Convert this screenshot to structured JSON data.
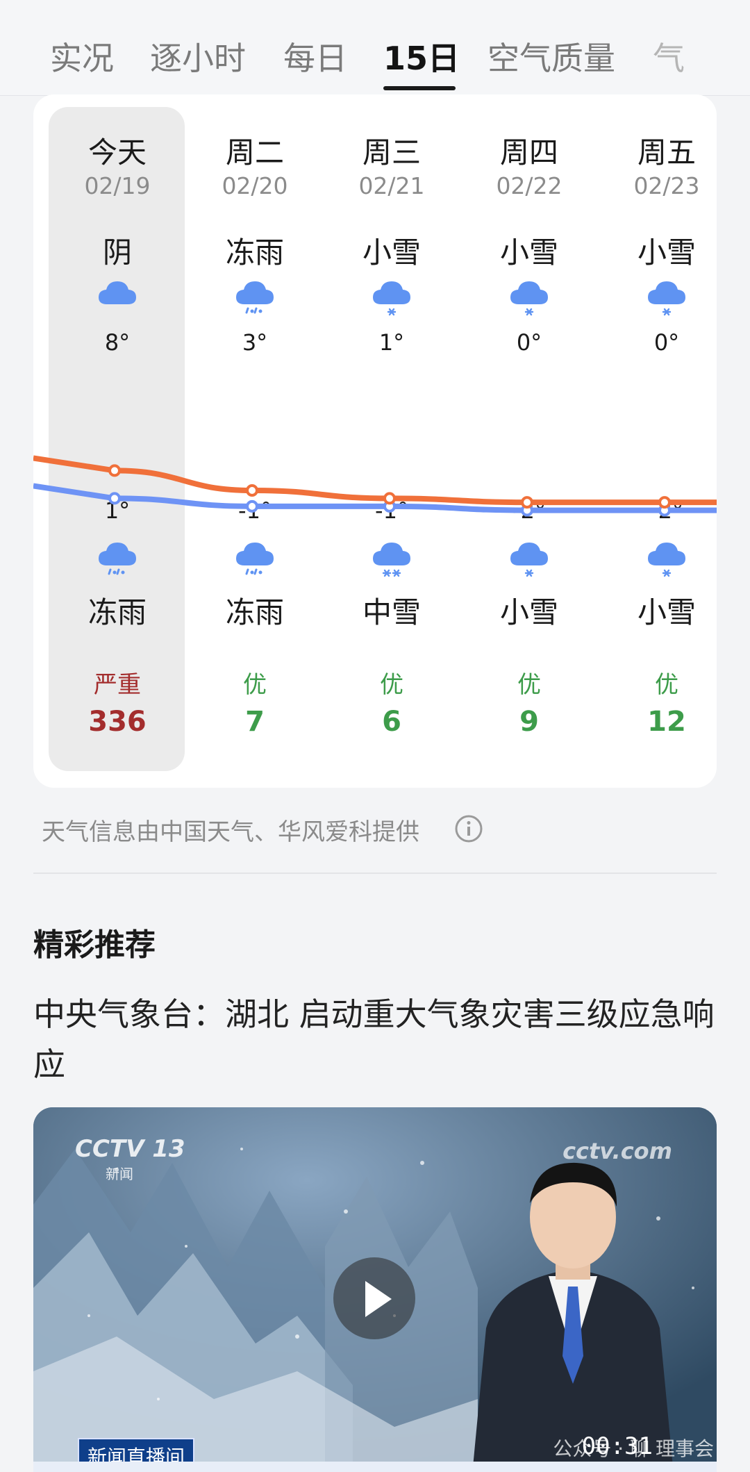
{
  "tabs": [
    {
      "label": "实况",
      "active": false
    },
    {
      "label": "逐小时",
      "active": false
    },
    {
      "label": "每日",
      "active": false
    },
    {
      "label": "15日",
      "active": true
    },
    {
      "label": "空气质量",
      "active": false
    },
    {
      "label": "气",
      "active": false
    }
  ],
  "forecast": {
    "days": [
      {
        "day": "今天",
        "date": "02/19",
        "cond_day": "阴",
        "icon_day": "cloudy-icon",
        "high": "8°",
        "low": "1°",
        "icon_night": "freezing-rain-icon",
        "cond_night": "冻雨",
        "aqi_level": "严重",
        "aqi_value": "336",
        "aqi_color": "#a32d2d"
      },
      {
        "day": "周二",
        "date": "02/20",
        "cond_day": "冻雨",
        "icon_day": "freezing-rain-icon",
        "high": "3°",
        "low": "-1°",
        "icon_night": "freezing-rain-icon",
        "cond_night": "冻雨",
        "aqi_level": "优",
        "aqi_value": "7",
        "aqi_color": "#3d9c4a"
      },
      {
        "day": "周三",
        "date": "02/21",
        "cond_day": "小雪",
        "icon_day": "light-snow-icon",
        "high": "1°",
        "low": "-1°",
        "icon_night": "moderate-snow-icon",
        "cond_night": "中雪",
        "aqi_level": "优",
        "aqi_value": "6",
        "aqi_color": "#3d9c4a"
      },
      {
        "day": "周四",
        "date": "02/22",
        "cond_day": "小雪",
        "icon_day": "light-snow-icon",
        "high": "0°",
        "low": "-2°",
        "icon_night": "light-snow-icon",
        "cond_night": "小雪",
        "aqi_level": "优",
        "aqi_value": "9",
        "aqi_color": "#3d9c4a"
      },
      {
        "day": "周五",
        "date": "02/23",
        "cond_day": "小雪",
        "icon_day": "light-snow-icon",
        "high": "0°",
        "low": "-2°",
        "icon_night": "light-snow-icon",
        "cond_night": "小雪",
        "aqi_level": "优",
        "aqi_value": "12",
        "aqi_color": "#3d9c4a"
      }
    ],
    "high_temps": [
      8,
      3,
      1,
      0,
      0
    ],
    "low_temps": [
      1,
      -1,
      -1,
      -2,
      -2
    ],
    "high_color": "#f0703a",
    "low_color": "#6e93f5",
    "icon_color": "#5f93f2"
  },
  "source_text": "天气信息由中国天气、华风爱科提供",
  "recommend": {
    "title": "精彩推荐",
    "headline": "中央气象台：湖北 启动重大气象灾害三级应急响应",
    "video": {
      "logo_left": "CCTV 13",
      "logo_left_sub": "新闻",
      "logo_right": "cctv.com",
      "tag": "新闻直播间",
      "duration": "00:31",
      "watermark": "公众号 · 聊  理事会"
    }
  }
}
